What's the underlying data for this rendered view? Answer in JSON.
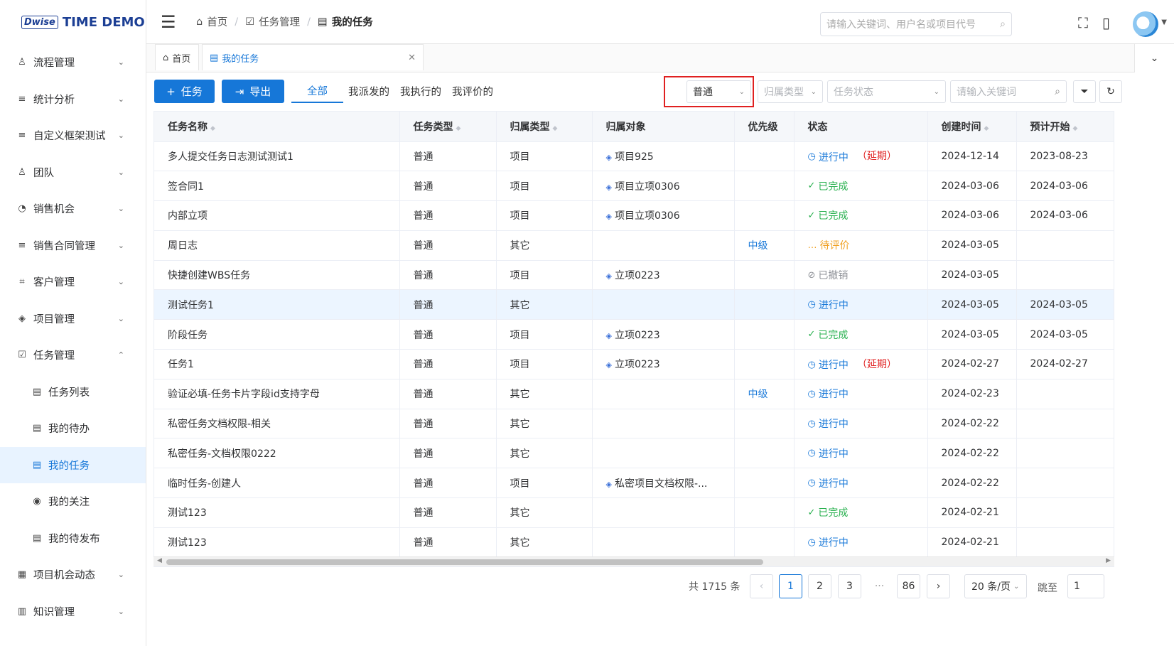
{
  "brand": {
    "mark": "Dwise",
    "name": "TIME DEMO"
  },
  "sidebar": {
    "items": [
      {
        "label": "流程管理",
        "icon": "user-icon",
        "glyph": "♙",
        "chev": "⌄"
      },
      {
        "label": "统计分析",
        "icon": "list-icon",
        "glyph": "≡",
        "chev": "⌄"
      },
      {
        "label": "自定义框架测试",
        "icon": "list-icon",
        "glyph": "≡",
        "chev": "⌄"
      },
      {
        "label": "团队",
        "icon": "team-icon",
        "glyph": "♙",
        "chev": "⌄"
      },
      {
        "label": "销售机会",
        "icon": "pie-icon",
        "glyph": "◔",
        "chev": "⌄"
      },
      {
        "label": "销售合同管理",
        "icon": "list-icon",
        "glyph": "≡",
        "chev": "⌄"
      },
      {
        "label": "客户管理",
        "icon": "customer-icon",
        "glyph": "⌗",
        "chev": "⌄"
      },
      {
        "label": "项目管理",
        "icon": "layers-icon",
        "glyph": "◈",
        "chev": "⌄"
      },
      {
        "label": "任务管理",
        "icon": "checkbox-icon",
        "glyph": "☑",
        "chev": "⌃"
      }
    ],
    "sub_items": [
      {
        "label": "任务列表",
        "icon": "document-icon",
        "glyph": "▤"
      },
      {
        "label": "我的待办",
        "icon": "todo-icon",
        "glyph": "▤"
      },
      {
        "label": "我的任务",
        "icon": "my-task-icon",
        "glyph": "▤"
      },
      {
        "label": "我的关注",
        "icon": "eye-icon",
        "glyph": "◉"
      },
      {
        "label": "我的待发布",
        "icon": "publish-icon",
        "glyph": "▤"
      }
    ],
    "bottom_items": [
      {
        "label": "项目机会动态",
        "icon": "calendar-icon",
        "glyph": "▦",
        "chev": "⌄"
      },
      {
        "label": "知识管理",
        "icon": "book-icon",
        "glyph": "▥",
        "chev": "⌄"
      }
    ]
  },
  "header": {
    "crumbs": [
      "首页",
      "任务管理",
      "我的任务"
    ],
    "search_placeholder": "请输入关键词、用户名或项目代号"
  },
  "tabs": {
    "home": "首页",
    "active": "我的任务"
  },
  "toolbar": {
    "add_label": "任务",
    "export_label": "导出",
    "filter_tabs": [
      "全部",
      "我派发的",
      "我执行的",
      "我评价的"
    ],
    "type_value": "普通",
    "belong_placeholder": "归属类型",
    "status_placeholder": "任务状态",
    "keyword_placeholder": "请输入关键词"
  },
  "table": {
    "columns": [
      "任务名称",
      "任务类型",
      "归属类型",
      "归属对象",
      "优先级",
      "状态",
      "创建时间",
      "预计开始"
    ],
    "rows": [
      {
        "name": "多人提交任务日志测试测试1",
        "type": "普通",
        "belong": "项目",
        "object": "项目925",
        "priority": "",
        "status": "进行中",
        "late": "（延期）",
        "created": "2024-12-14",
        "start": "2023-08-23"
      },
      {
        "name": "签合同1",
        "type": "普通",
        "belong": "项目",
        "object": "项目立项0306",
        "priority": "",
        "status": "已完成",
        "late": "",
        "created": "2024-03-06",
        "start": "2024-03-06"
      },
      {
        "name": "内部立项",
        "type": "普通",
        "belong": "项目",
        "object": "项目立项0306",
        "priority": "",
        "status": "已完成",
        "late": "",
        "created": "2024-03-06",
        "start": "2024-03-06"
      },
      {
        "name": "周日志",
        "type": "普通",
        "belong": "其它",
        "object": "",
        "priority": "中级",
        "status": "待评价",
        "late": "",
        "created": "2024-03-05",
        "start": ""
      },
      {
        "name": "快捷创建WBS任务",
        "type": "普通",
        "belong": "项目",
        "object": "立项0223",
        "priority": "",
        "status": "已撤销",
        "late": "",
        "created": "2024-03-05",
        "start": ""
      },
      {
        "name": "测试任务1",
        "type": "普通",
        "belong": "其它",
        "object": "",
        "priority": "",
        "status": "进行中",
        "late": "",
        "created": "2024-03-05",
        "start": "2024-03-05"
      },
      {
        "name": "阶段任务",
        "type": "普通",
        "belong": "项目",
        "object": "立项0223",
        "priority": "",
        "status": "已完成",
        "late": "",
        "created": "2024-03-05",
        "start": "2024-03-05"
      },
      {
        "name": "任务1",
        "type": "普通",
        "belong": "项目",
        "object": "立项0223",
        "priority": "",
        "status": "进行中",
        "late": "（延期）",
        "created": "2024-02-27",
        "start": "2024-02-27"
      },
      {
        "name": "验证必填-任务卡片字段id支持字母",
        "type": "普通",
        "belong": "其它",
        "object": "",
        "priority": "中级",
        "status": "进行中",
        "late": "",
        "created": "2024-02-23",
        "start": ""
      },
      {
        "name": "私密任务文档权限-相关",
        "type": "普通",
        "belong": "其它",
        "object": "",
        "priority": "",
        "status": "进行中",
        "late": "",
        "created": "2024-02-22",
        "start": ""
      },
      {
        "name": "私密任务-文档权限0222",
        "type": "普通",
        "belong": "其它",
        "object": "",
        "priority": "",
        "status": "进行中",
        "late": "",
        "created": "2024-02-22",
        "start": ""
      },
      {
        "name": "临时任务-创建人",
        "type": "普通",
        "belong": "项目",
        "object": "私密项目文档权限-...",
        "priority": "",
        "status": "进行中",
        "late": "",
        "created": "2024-02-22",
        "start": ""
      },
      {
        "name": "测试123",
        "type": "普通",
        "belong": "其它",
        "object": "",
        "priority": "",
        "status": "已完成",
        "late": "",
        "created": "2024-02-21",
        "start": ""
      },
      {
        "name": "测试123",
        "type": "普通",
        "belong": "其它",
        "object": "",
        "priority": "",
        "status": "进行中",
        "late": "",
        "created": "2024-02-21",
        "start": ""
      }
    ]
  },
  "pagination": {
    "total": "共 1715 条",
    "pages": [
      "1",
      "2",
      "3",
      "···",
      "86"
    ],
    "current": "1",
    "page_size": "20 条/页",
    "jump_label": "跳至",
    "jump_value": "1"
  },
  "colors": {
    "accent": "#1677d8",
    "done": "#27b04e",
    "warn": "#f0a020",
    "danger": "#e02020"
  }
}
